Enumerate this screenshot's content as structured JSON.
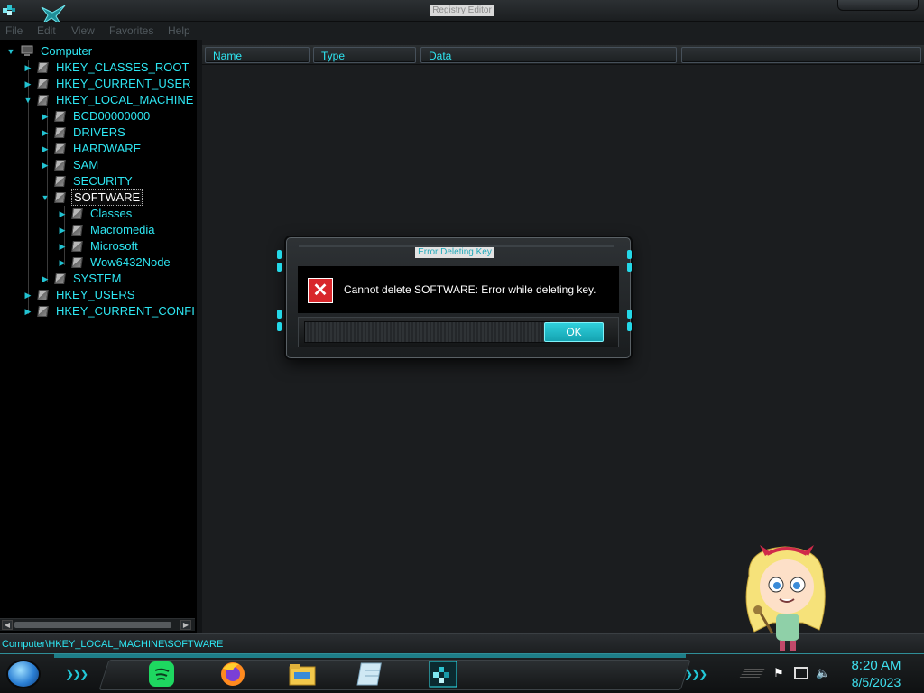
{
  "window": {
    "title": "Registry Editor"
  },
  "menu": [
    "File",
    "Edit",
    "View",
    "Favorites",
    "Help"
  ],
  "tree": {
    "root": "Computer",
    "items": [
      {
        "label": "HKEY_CLASSES_ROOT",
        "level": 1,
        "expander": "collapsed"
      },
      {
        "label": "HKEY_CURRENT_USER",
        "level": 1,
        "expander": "collapsed"
      },
      {
        "label": "HKEY_LOCAL_MACHINE",
        "level": 1,
        "expander": "expanded"
      },
      {
        "label": "BCD00000000",
        "level": 2,
        "expander": "collapsed"
      },
      {
        "label": "DRIVERS",
        "level": 2,
        "expander": "collapsed"
      },
      {
        "label": "HARDWARE",
        "level": 2,
        "expander": "collapsed"
      },
      {
        "label": "SAM",
        "level": 2,
        "expander": "collapsed"
      },
      {
        "label": "SECURITY",
        "level": 2,
        "expander": "none"
      },
      {
        "label": "SOFTWARE",
        "level": 2,
        "expander": "expanded",
        "selected": true
      },
      {
        "label": "Classes",
        "level": 3,
        "expander": "collapsed"
      },
      {
        "label": "Macromedia",
        "level": 3,
        "expander": "collapsed"
      },
      {
        "label": "Microsoft",
        "level": 3,
        "expander": "collapsed"
      },
      {
        "label": "Wow6432Node",
        "level": 3,
        "expander": "collapsed"
      },
      {
        "label": "SYSTEM",
        "level": 2,
        "expander": "collapsed"
      },
      {
        "label": "HKEY_USERS",
        "level": 1,
        "expander": "collapsed"
      },
      {
        "label": "HKEY_CURRENT_CONFI",
        "level": 1,
        "expander": "collapsed"
      }
    ]
  },
  "list": {
    "columns": [
      "Name",
      "Type",
      "Data"
    ]
  },
  "status": {
    "path": "Computer\\HKEY_LOCAL_MACHINE\\SOFTWARE"
  },
  "dialog": {
    "title": "Error Deleting Key",
    "icon": "error-icon",
    "message": "Cannot delete SOFTWARE:  Error while deleting key.",
    "ok_label": "OK"
  },
  "taskbar": {
    "apps": [
      "spotify-icon",
      "firefox-icon",
      "file-explorer-icon",
      "notepad-icon",
      "registry-editor-icon"
    ],
    "tray_icons": [
      "flag-icon",
      "network-icon",
      "volume-icon"
    ]
  },
  "clock": {
    "time": "8:20 AM",
    "date": "8/5/2023"
  },
  "colors": {
    "accent": "#2ee6f2",
    "error": "#d8272b",
    "button": "#1fb8c6"
  }
}
